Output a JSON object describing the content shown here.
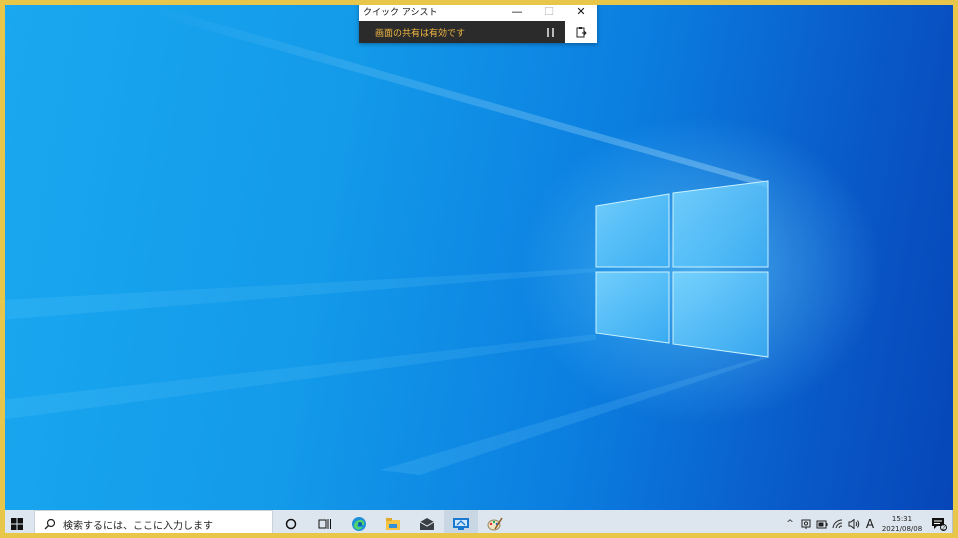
{
  "quick_assist": {
    "title": "クイック アシスト",
    "minimize_glyph": "—",
    "maximize_glyph": "☐",
    "close_glyph": "✕",
    "status_text": "画面の共有は有効です",
    "pause_icon": "pause-icon",
    "clipboard_icon": "clipboard-icon",
    "status_color": "#f4b942"
  },
  "taskbar": {
    "search_placeholder": "検索するには、ここに入力します",
    "pinned": [
      {
        "name": "cortana-icon"
      },
      {
        "name": "task-view-icon"
      },
      {
        "name": "edge-icon"
      },
      {
        "name": "file-explorer-icon"
      },
      {
        "name": "mail-icon"
      },
      {
        "name": "quick-assist-icon",
        "active": true
      },
      {
        "name": "paint-icon"
      }
    ],
    "tray": {
      "chevron": "^",
      "ime_mode": "A",
      "time": "15:31",
      "date": "2021/08/08",
      "notification_count": "2"
    }
  },
  "colors": {
    "desktop_blue": "#0b7ee0",
    "frame_yellow": "#e8c64a",
    "taskbar": "#dde6ee"
  }
}
